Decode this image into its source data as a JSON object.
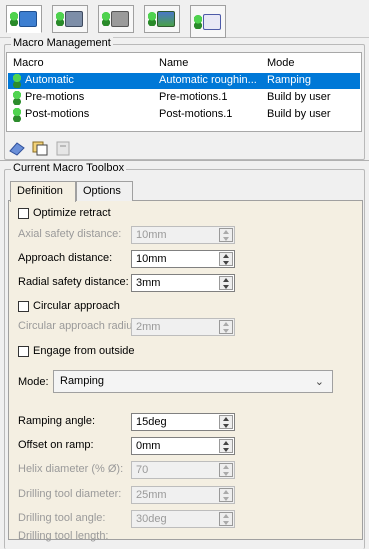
{
  "macro_management": {
    "title": "Macro Management",
    "columns": [
      "Macro",
      "Name",
      "Mode"
    ],
    "rows": [
      {
        "macro": "Automatic",
        "name": "Automatic roughin...",
        "mode": "Ramping",
        "selected": true
      },
      {
        "macro": "Pre-motions",
        "name": "Pre-motions.1",
        "mode": "Build by user",
        "selected": false
      },
      {
        "macro": "Post-motions",
        "name": "Post-motions.1",
        "mode": "Build by user",
        "selected": false
      }
    ]
  },
  "toolbox": {
    "title": "Current Macro Toolbox",
    "tabs": [
      "Definition",
      "Options"
    ],
    "optimize_retract": "Optimize retract",
    "axial_safety": {
      "label": "Axial safety distance:",
      "value": "10mm"
    },
    "approach": {
      "label": "Approach distance:",
      "value": "10mm"
    },
    "radial_safety": {
      "label": "Radial safety distance:",
      "value": "3mm"
    },
    "circular_approach": "Circular approach",
    "circular_radius": {
      "label": "Circular approach radius:",
      "value": "2mm"
    },
    "engage_outside": "Engage from outside",
    "mode": {
      "label": "Mode:",
      "value": "Ramping"
    },
    "ramping_angle": {
      "label": "Ramping angle:",
      "value": "15deg"
    },
    "offset_ramp": {
      "label": "Offset on ramp:",
      "value": "0mm"
    },
    "helix_diameter": {
      "label": "Helix diameter (% Ø):",
      "value": "70"
    },
    "drill_diameter": {
      "label": "Drilling tool diameter:",
      "value": "25mm"
    },
    "drill_angle": {
      "label": "Drilling tool angle:",
      "value": "30deg"
    },
    "drill_length_partial": "Drilling tool length:"
  }
}
